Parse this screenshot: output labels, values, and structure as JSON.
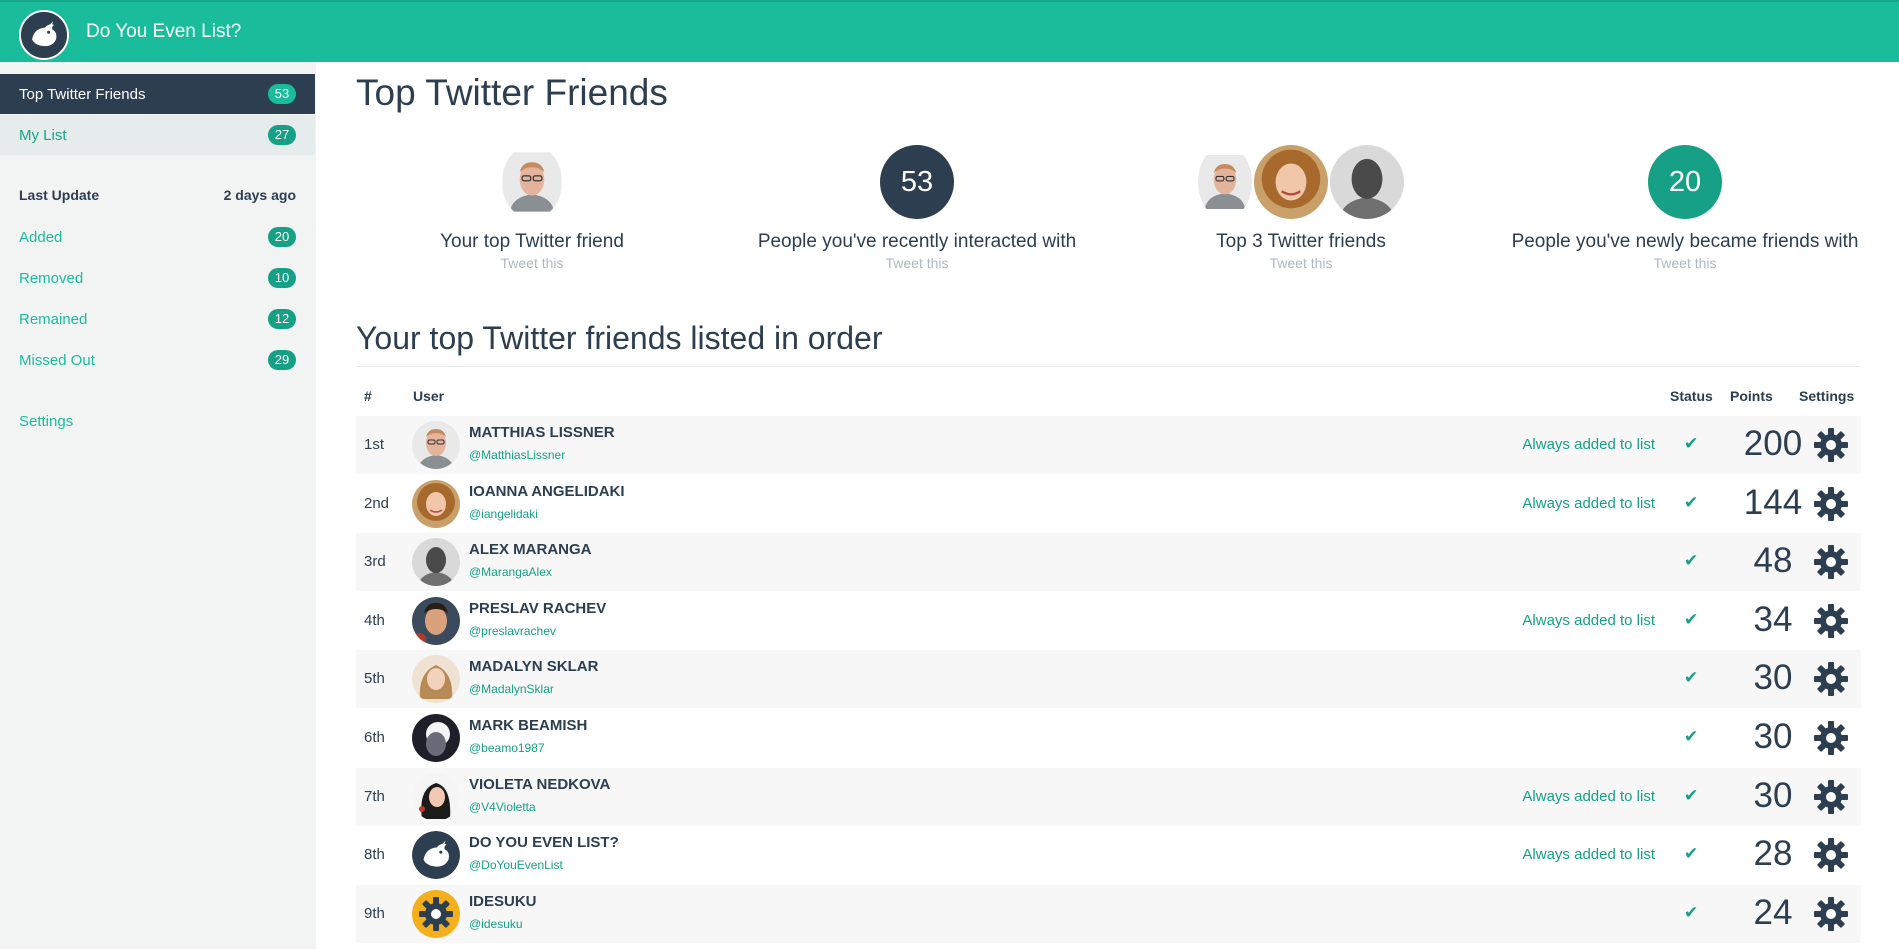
{
  "app": {
    "title": "Do You Even List?"
  },
  "sidebar": {
    "nav": [
      {
        "label": "Top Twitter Friends",
        "count": "53"
      },
      {
        "label": "My List",
        "count": "27"
      }
    ],
    "last_update_label": "Last Update",
    "last_update_value": "2 days ago",
    "stats": [
      {
        "label": "Added",
        "count": "20"
      },
      {
        "label": "Removed",
        "count": "10"
      },
      {
        "label": "Remained",
        "count": "12"
      },
      {
        "label": "Missed Out",
        "count": "29"
      }
    ],
    "settings_label": "Settings"
  },
  "main": {
    "title": "Top Twitter Friends",
    "summary": [
      {
        "caption": "Your top Twitter friend",
        "tweet": "Tweet this"
      },
      {
        "number": "53",
        "caption": "People you've recently interacted with",
        "tweet": "Tweet this"
      },
      {
        "caption": "Top 3 Twitter friends",
        "tweet": "Tweet this"
      },
      {
        "number": "20",
        "caption": "People you've newly became friends with",
        "tweet": "Tweet this"
      }
    ],
    "list_title": "Your top Twitter friends listed in order",
    "columns": {
      "rank": "#",
      "user": "User",
      "status": "Status",
      "points": "Points",
      "settings": "Settings"
    },
    "always_text": "Always added to list",
    "rows": [
      {
        "rank": "1st",
        "name": "MATTHIAS LISSNER",
        "handle": "@MatthiasLissner",
        "always": true,
        "points": "200",
        "avatar": "man-glasses"
      },
      {
        "rank": "2nd",
        "name": "IOANNA ANGELIDAKI",
        "handle": "@iangelidaki",
        "always": true,
        "points": "144",
        "avatar": "woman-curly"
      },
      {
        "rank": "3rd",
        "name": "ALEX MARANGA",
        "handle": "@MarangaAlex",
        "always": false,
        "points": "48",
        "avatar": "man-gray"
      },
      {
        "rank": "4th",
        "name": "PRESLAV RACHEV",
        "handle": "@preslavrachev",
        "always": true,
        "points": "34",
        "avatar": "man-dark"
      },
      {
        "rank": "5th",
        "name": "MADALYN SKLAR",
        "handle": "@MadalynSklar",
        "always": false,
        "points": "30",
        "avatar": "woman-blonde"
      },
      {
        "rank": "6th",
        "name": "MARK BEAMISH",
        "handle": "@beamo1987",
        "always": false,
        "points": "30",
        "avatar": "man-light"
      },
      {
        "rank": "7th",
        "name": "VIOLETA NEDKOVA",
        "handle": "@V4Violetta",
        "always": true,
        "points": "30",
        "avatar": "woman-dark"
      },
      {
        "rank": "8th",
        "name": "DO YOU EVEN LIST?",
        "handle": "@DoYouEvenList",
        "always": true,
        "points": "28",
        "avatar": "app-logo"
      },
      {
        "rank": "9th",
        "name": "IDESUKU",
        "handle": "@idesuku",
        "always": false,
        "points": "24",
        "avatar": "gear-logo"
      }
    ]
  },
  "colors": {
    "accent": "#1abc9c",
    "accent_dark": "#16a085",
    "navy": "#2c3e50"
  }
}
